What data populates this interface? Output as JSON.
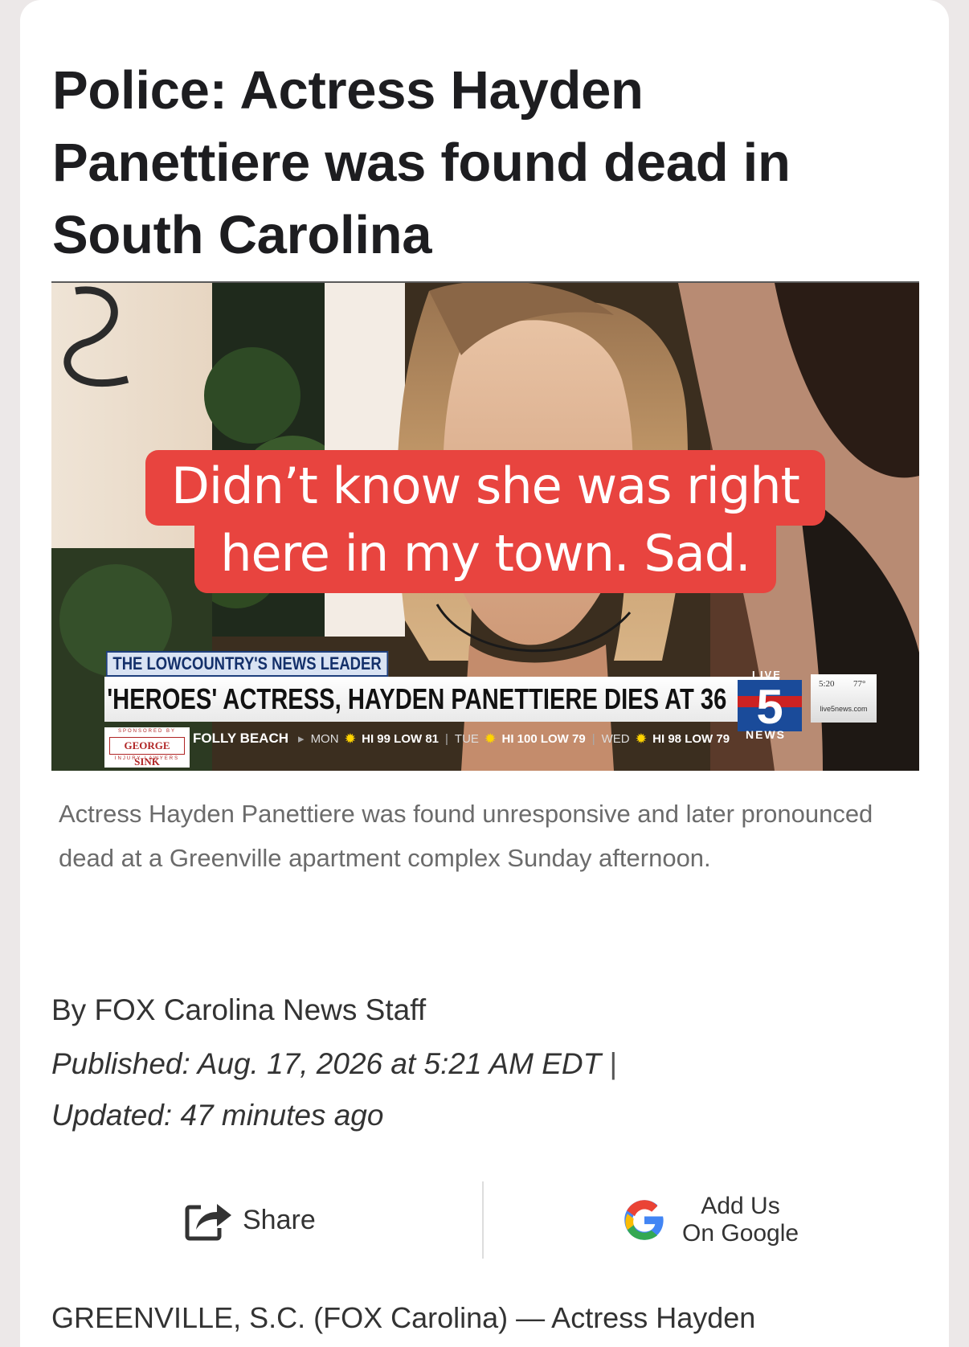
{
  "article": {
    "headline": "Police: Actress Hayden Panettiere was found dead in South Carolina",
    "caption": "Actress Hayden Panettiere was found unresponsive and later pronounced dead at a Greenville apartment complex Sunday afternoon.",
    "byline": "By FOX Carolina News Staff",
    "published": "Published: Aug. 17, 2026 at 5:21 AM EDT",
    "published_separator": "|",
    "updated": "Updated: 47 minutes ago",
    "dateline_start": "GREENVILLE, S.C. (FOX Carolina) — Actress Hayden"
  },
  "overlay": {
    "line1": "Didn’t know she was right",
    "line2": "here in my town. Sad.",
    "color": "#e8443f"
  },
  "broadcast": {
    "tag": "THE LOWCOUNTRY'S NEWS LEADER",
    "headline": "'HEROES' ACTRESS, HAYDEN PANETTIERE DIES AT 36",
    "live": "LIVE",
    "channel": "5",
    "news": "NEWS",
    "time": "5:20",
    "temperature": "77°",
    "site": "live5news.com",
    "sponsor_top": "SPONSORED BY",
    "sponsor_name": "GEORGE SINK",
    "sponsor_bottom": "INJURY LAWYERS",
    "location": "FOLLY BEACH",
    "forecast": [
      {
        "day": "MON",
        "range": "HI 99 LOW 81"
      },
      {
        "day": "TUE",
        "range": "HI 100 LOW 79"
      },
      {
        "day": "WED",
        "range": "HI 98 LOW 79"
      }
    ]
  },
  "actions": {
    "share_label": "Share",
    "google_line1": "Add Us",
    "google_line2": "On Google"
  },
  "icons": {
    "share": "share-icon",
    "google": "google-icon",
    "sun": "sun-icon"
  },
  "colors": {
    "headline": "#1d1d20",
    "caption": "#6b6b6b",
    "body": "#333333"
  }
}
